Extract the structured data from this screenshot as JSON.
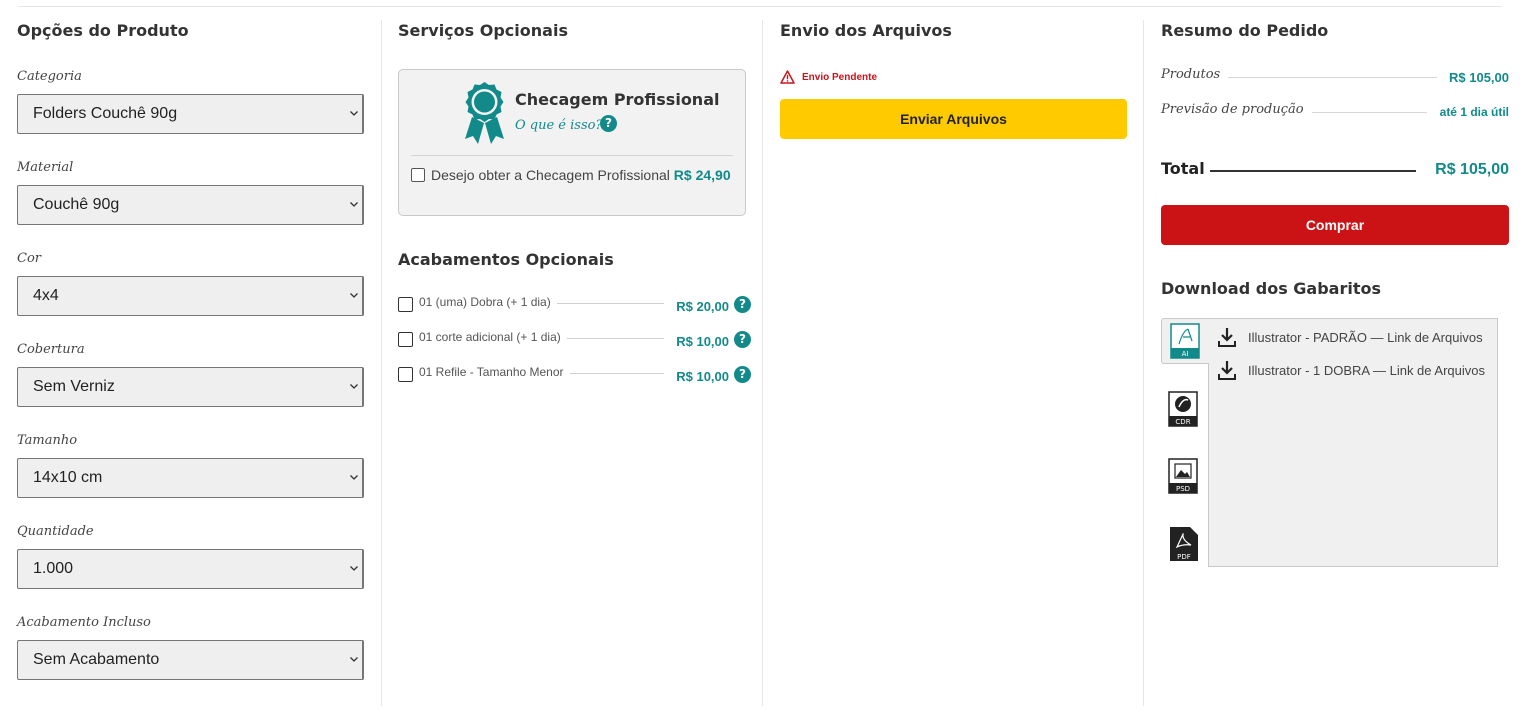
{
  "options": {
    "title": "Opções do Produto",
    "fields": [
      {
        "label": "Categoria",
        "value": "Folders Couchê 90g"
      },
      {
        "label": "Material",
        "value": "Couchê 90g"
      },
      {
        "label": "Cor",
        "value": "4x4"
      },
      {
        "label": "Cobertura",
        "value": "Sem Verniz"
      },
      {
        "label": "Tamanho",
        "value": "14x10 cm"
      },
      {
        "label": "Quantidade",
        "value": "1.000"
      },
      {
        "label": "Acabamento Incluso",
        "value": "Sem Acabamento"
      }
    ]
  },
  "services": {
    "title": "Serviços Opcionais",
    "card": {
      "title": "Checagem Profissional",
      "link": "O que é isso?",
      "checkbox_label": "Desejo obter a Checagem Profissional",
      "price": "R$ 24,90",
      "checked": false
    },
    "finishes_title": "Acabamentos Opcionais",
    "finishes": [
      {
        "label": "01 (uma) Dobra (+ 1 dia)",
        "price": "R$ 20,00",
        "checked": false
      },
      {
        "label": "01 corte adicional (+ 1 dia)",
        "price": "R$ 10,00",
        "checked": false
      },
      {
        "label": "01 Refile - Tamanho Menor",
        "price": "R$ 10,00",
        "checked": false
      }
    ],
    "help_glyph": "?"
  },
  "upload": {
    "title": "Envio dos Arquivos",
    "status": "Envio Pendente",
    "button": "Enviar Arquivos"
  },
  "summary": {
    "title": "Resumo do Pedido",
    "products_label": "Produtos",
    "products_value": "R$ 105,00",
    "production_label": "Previsão de produção",
    "production_value": "até 1 dia útil",
    "total_label": "Total",
    "total_value": "R$ 105,00",
    "buy_button": "Comprar"
  },
  "templates": {
    "title": "Download dos Gabaritos",
    "file_types": [
      {
        "name": "AI",
        "icon": "illustrator-icon",
        "active": true
      },
      {
        "name": "CDR",
        "icon": "coreldraw-icon",
        "active": false
      },
      {
        "name": "PSD",
        "icon": "photoshop-icon",
        "active": false
      },
      {
        "name": "PDF",
        "icon": "pdf-icon",
        "active": false
      }
    ],
    "links": [
      "Illustrator - PADRÃO — Link de Arquivos",
      "Illustrator - 1 DOBRA — Link de Arquivos"
    ]
  },
  "colors": {
    "teal": "#138a8a",
    "yellow": "#ffca00",
    "red": "#cb1316"
  }
}
